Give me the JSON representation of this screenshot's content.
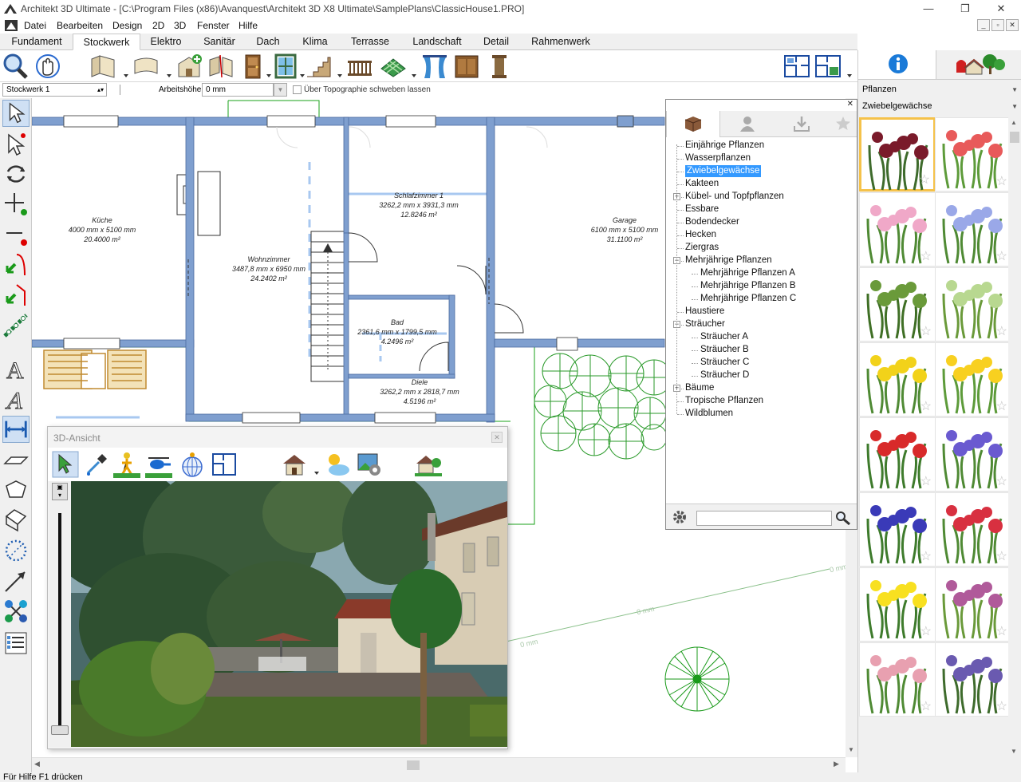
{
  "window": {
    "title": "Architekt 3D Ultimate - [C:\\Program Files (x86)\\Avanquest\\Architekt 3D X8 Ultimate\\SamplePlans\\ClassicHouse1.PRO]",
    "minimize": "—",
    "maximize": "❐",
    "close": "✕"
  },
  "menu": {
    "items": [
      "Datei",
      "Bearbeiten",
      "Design",
      "2D",
      "3D",
      "Fenster",
      "Hilfe"
    ],
    "mdi": [
      "_",
      "▫",
      "✕"
    ]
  },
  "tabs": [
    "Fundament",
    "Stockwerk",
    "Elektro",
    "Sanitär",
    "Dach",
    "Klima",
    "Terrasse",
    "Landschaft",
    "Detail",
    "Rahmenwerk"
  ],
  "active_tab": "Stockwerk",
  "options": {
    "floor": "Stockwerk 1",
    "height_label": "Arbeitshöhe:",
    "height_value": "0 mm",
    "terrain_label": "Über Topographie schweben lassen"
  },
  "rooms": [
    {
      "name": "Küche",
      "dims": "4000 mm x 5100 mm",
      "area": "20.4000 m²"
    },
    {
      "name": "Wohnzimmer",
      "dims": "3487,8 mm x 6950 mm",
      "area": "24.2402 m²"
    },
    {
      "name": "Schlafzimmer 1",
      "dims": "3262,2 mm x 3931,3 mm",
      "area": "12.8246 m²"
    },
    {
      "name": "Garage",
      "dims": "6100 mm x 5100 mm",
      "area": "31.1100 m²"
    },
    {
      "name": "Bad",
      "dims": "2361,6 mm x 1799,5 mm",
      "area": "4.2496 m²"
    },
    {
      "name": "Diele",
      "dims": "3262,2 mm x 2818,7 mm",
      "area": "4.5196 m²"
    }
  ],
  "dim_labels": [
    "0 mm",
    "0 mm",
    "0 mm"
  ],
  "view3d": {
    "title": "3D-Ansicht",
    "close": "✕"
  },
  "tree": {
    "close": "✕",
    "items": [
      {
        "label": "Einjährige Pflanzen",
        "level": 0,
        "toggle": ""
      },
      {
        "label": "Wasserpflanzen",
        "level": 0,
        "toggle": ""
      },
      {
        "label": "Zwiebelgewächse",
        "level": 0,
        "toggle": "",
        "selected": true
      },
      {
        "label": "Kakteen",
        "level": 0,
        "toggle": ""
      },
      {
        "label": "Kübel- und Topfpflanzen",
        "level": 0,
        "toggle": "+"
      },
      {
        "label": "Essbare",
        "level": 0,
        "toggle": ""
      },
      {
        "label": "Bodendecker",
        "level": 0,
        "toggle": ""
      },
      {
        "label": "Hecken",
        "level": 0,
        "toggle": ""
      },
      {
        "label": "Ziergras",
        "level": 0,
        "toggle": ""
      },
      {
        "label": "Mehrjährige Pflanzen",
        "level": 0,
        "toggle": "−"
      },
      {
        "label": "Mehrjährige Pflanzen A",
        "level": 1,
        "toggle": ""
      },
      {
        "label": "Mehrjährige Pflanzen B",
        "level": 1,
        "toggle": ""
      },
      {
        "label": "Mehrjährige Pflanzen C",
        "level": 1,
        "toggle": ""
      },
      {
        "label": "Haustiere",
        "level": 0,
        "toggle": ""
      },
      {
        "label": "Sträucher",
        "level": 0,
        "toggle": "−"
      },
      {
        "label": "Sträucher A",
        "level": 1,
        "toggle": ""
      },
      {
        "label": "Sträucher B",
        "level": 1,
        "toggle": ""
      },
      {
        "label": "Sträucher C",
        "level": 1,
        "toggle": ""
      },
      {
        "label": "Sträucher D",
        "level": 1,
        "toggle": ""
      },
      {
        "label": "Bäume",
        "level": 0,
        "toggle": "+"
      },
      {
        "label": "Tropische Pflanzen",
        "level": 0,
        "toggle": ""
      },
      {
        "label": "Wildblumen",
        "level": 0,
        "toggle": ""
      }
    ],
    "search_value": ""
  },
  "catalog": {
    "category": "Pflanzen",
    "subcategory": "Zwiebelgewächse",
    "star": "☆",
    "plants": [
      {
        "c1": "#7a1a2a",
        "c2": "#3e6b2c"
      },
      {
        "c1": "#e85a5a",
        "c2": "#5d9b3a"
      },
      {
        "c1": "#f0a8c8",
        "c2": "#4f8a34"
      },
      {
        "c1": "#9aa8e8",
        "c2": "#4f8a34"
      },
      {
        "c1": "#6a9a3a",
        "c2": "#3f6f25"
      },
      {
        "c1": "#b8d890",
        "c2": "#6a9a3a"
      },
      {
        "c1": "#f2d21a",
        "c2": "#4f8a34"
      },
      {
        "c1": "#f8d020",
        "c2": "#5d9b3a"
      },
      {
        "c1": "#d82a2a",
        "c2": "#3e7b2c"
      },
      {
        "c1": "#6a5ad0",
        "c2": "#4f8a34"
      },
      {
        "c1": "#3a3ab8",
        "c2": "#3e7b2c"
      },
      {
        "c1": "#d83040",
        "c2": "#4f8a34"
      },
      {
        "c1": "#f8e020",
        "c2": "#3e7b2c"
      },
      {
        "c1": "#b05a9a",
        "c2": "#6a9a3a"
      },
      {
        "c1": "#e8a0b0",
        "c2": "#4f8a34"
      },
      {
        "c1": "#6a5ab0",
        "c2": "#3e6b2c"
      }
    ]
  },
  "status": "Für Hilfe F1 drücken"
}
